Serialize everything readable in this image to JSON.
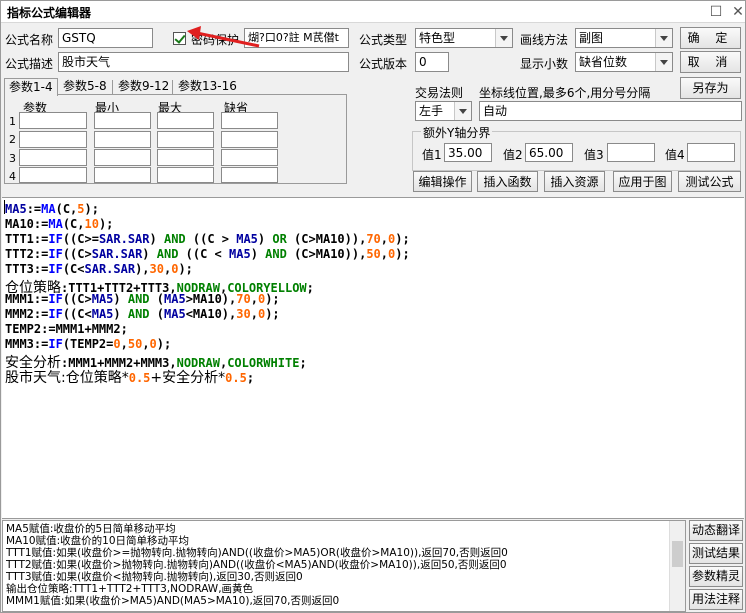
{
  "window": {
    "title": "指标公式编辑器",
    "max_icon": "☐",
    "close_icon": "✕"
  },
  "form": {
    "name_label": "公式名称",
    "name_value": "GSTQ",
    "pwd_checkbox_label": "密码保护",
    "pwd_value": "煳?口0?註  M芪僣t",
    "desc_label": "公式描述",
    "desc_value": "股市天气",
    "type_label": "公式类型",
    "type_value": "特色型",
    "draw_label": "画线方法",
    "draw_value": "副图",
    "version_label": "公式版本",
    "version_value": "0",
    "decimals_label": "显示小数",
    "decimals_value": "缺省位数"
  },
  "buttons": {
    "ok": "确  定",
    "cancel": "取  消",
    "save_as": "另存为",
    "edit_ops": "编辑操作",
    "insert_func": "插入函数",
    "insert_res": "插入资源",
    "apply_chart": "应用于图",
    "test_formula": "测试公式"
  },
  "tabs": [
    "参数1-4",
    "参数5-8",
    "参数9-12",
    "参数13-16"
  ],
  "params": {
    "headers": [
      "参数",
      "最小",
      "最大",
      "缺省"
    ],
    "rows": [
      "1",
      "2",
      "3",
      "4"
    ]
  },
  "trade": {
    "rule_label": "交易法则",
    "coord_label": "坐标线位置,最多6个,用分号分隔",
    "rule_value": "左手",
    "coord_value": "自动"
  },
  "yaxis": {
    "title": "额外Y轴分界",
    "v1_label": "值1",
    "v1": "35.00",
    "v2_label": "值2",
    "v2": "65.00",
    "v3_label": "值3",
    "v3": "",
    "v4_label": "值4",
    "v4": ""
  },
  "code_lines": [
    [
      {
        "t": "MA5",
        "c": "kp"
      },
      {
        "t": ":="
      },
      {
        "t": "MA",
        "c": "kf"
      },
      {
        "t": "(C,"
      },
      {
        "t": "5",
        "c": "kc"
      },
      {
        "t": ");"
      }
    ],
    [
      {
        "t": "MA10:="
      },
      {
        "t": "MA",
        "c": "kf"
      },
      {
        "t": "(C,"
      },
      {
        "t": "10",
        "c": "kc"
      },
      {
        "t": ");"
      }
    ],
    [
      {
        "t": "TTT1:="
      },
      {
        "t": "IF",
        "c": "kf"
      },
      {
        "t": "((C>="
      },
      {
        "t": "SAR.SAR",
        "c": "kp"
      },
      {
        "t": ") "
      },
      {
        "t": "AND",
        "c": "kb"
      },
      {
        "t": " ((C > "
      },
      {
        "t": "MA5",
        "c": "kp"
      },
      {
        "t": ") "
      },
      {
        "t": "OR",
        "c": "kb"
      },
      {
        "t": " (C>MA10)),"
      },
      {
        "t": "70",
        "c": "kc"
      },
      {
        "t": ","
      },
      {
        "t": "0",
        "c": "kc"
      },
      {
        "t": ");"
      }
    ],
    [
      {
        "t": "TTT2:="
      },
      {
        "t": "IF",
        "c": "kf"
      },
      {
        "t": "((C>"
      },
      {
        "t": "SAR.SAR",
        "c": "kp"
      },
      {
        "t": ") "
      },
      {
        "t": "AND",
        "c": "kb"
      },
      {
        "t": " ((C < "
      },
      {
        "t": "MA5",
        "c": "kp"
      },
      {
        "t": ") "
      },
      {
        "t": "AND",
        "c": "kb"
      },
      {
        "t": " (C>MA10)),"
      },
      {
        "t": "50",
        "c": "kc"
      },
      {
        "t": ","
      },
      {
        "t": "0",
        "c": "kc"
      },
      {
        "t": ");"
      }
    ],
    [
      {
        "t": "TTT3:="
      },
      {
        "t": "IF",
        "c": "kf"
      },
      {
        "t": "(C<"
      },
      {
        "t": "SAR.SAR",
        "c": "kp"
      },
      {
        "t": "),"
      },
      {
        "t": "30",
        "c": "kc"
      },
      {
        "t": ","
      },
      {
        "t": "0",
        "c": "kc"
      },
      {
        "t": ");"
      }
    ],
    [
      {
        "t": "仓位策略",
        "cn": 1
      },
      {
        "t": ":TTT1+TTT2+TTT3,"
      },
      {
        "t": "NODRAW",
        "c": "kb"
      },
      {
        "t": ","
      },
      {
        "t": "COLORYELLOW",
        "c": "kb"
      },
      {
        "t": ";"
      }
    ],
    [
      {
        "t": "MMM1:="
      },
      {
        "t": "IF",
        "c": "kf"
      },
      {
        "t": "((C>"
      },
      {
        "t": "MA5",
        "c": "kp"
      },
      {
        "t": ") "
      },
      {
        "t": "AND",
        "c": "kb"
      },
      {
        "t": " ("
      },
      {
        "t": "MA5",
        "c": "kp"
      },
      {
        "t": ">MA10),"
      },
      {
        "t": "70",
        "c": "kc"
      },
      {
        "t": ","
      },
      {
        "t": "0",
        "c": "kc"
      },
      {
        "t": ");"
      }
    ],
    [
      {
        "t": "MMM2:="
      },
      {
        "t": "IF",
        "c": "kf"
      },
      {
        "t": "((C<"
      },
      {
        "t": "MA5",
        "c": "kp"
      },
      {
        "t": ") "
      },
      {
        "t": "AND",
        "c": "kb"
      },
      {
        "t": " ("
      },
      {
        "t": "MA5",
        "c": "kp"
      },
      {
        "t": "<MA10),"
      },
      {
        "t": "30",
        "c": "kc"
      },
      {
        "t": ","
      },
      {
        "t": "0",
        "c": "kc"
      },
      {
        "t": ");"
      }
    ],
    [
      {
        "t": "TEMP2:=MMM1+MMM2;"
      }
    ],
    [
      {
        "t": "MMM3:="
      },
      {
        "t": "IF",
        "c": "kf"
      },
      {
        "t": "(TEMP2="
      },
      {
        "t": "0",
        "c": "kc"
      },
      {
        "t": ","
      },
      {
        "t": "50",
        "c": "kc"
      },
      {
        "t": ","
      },
      {
        "t": "0",
        "c": "kc"
      },
      {
        "t": ");"
      }
    ],
    [
      {
        "t": "安全分析",
        "cn": 1
      },
      {
        "t": ":MMM1+MMM2+MMM3,"
      },
      {
        "t": "NODRAW",
        "c": "kb"
      },
      {
        "t": ","
      },
      {
        "t": "COLORWHITE",
        "c": "kb"
      },
      {
        "t": ";"
      }
    ],
    [
      {
        "t": "股市天气:仓位策略*",
        "cn": 1
      },
      {
        "t": "0.5",
        "c": "kc"
      },
      {
        "t": "+安全分析*",
        "cn": 1
      },
      {
        "t": "0.5",
        "c": "kc"
      },
      {
        "t": ";"
      }
    ]
  ],
  "output_lines": [
    "MA5赋值:收盘价的5日简单移动平均",
    "MA10赋值:收盘价的10日简单移动平均",
    "TTT1赋值:如果(收盘价>=抛物转向.抛物转向)AND((收盘价>MA5)OR(收盘价>MA10)),返回70,否则返回0",
    "TTT2赋值:如果(收盘价>抛物转向.抛物转向)AND((收盘价<MA5)AND(收盘价>MA10)),返回50,否则返回0",
    "TTT3赋值:如果(收盘价<抛物转向.抛物转向),返回30,否则返回0",
    "输出仓位策略:TTT1+TTT2+TTT3,NODRAW,画黄色",
    "MMM1赋值:如果(收盘价>MA5)AND(MA5>MA10),返回70,否则返回0"
  ],
  "side_buttons": [
    "动态翻译",
    "测试结果",
    "参数精灵",
    "用法注释"
  ],
  "colors": {
    "accent_arrow": "#e02020",
    "func": "#0000ff",
    "bool": "#008000",
    "const": "#ff6600"
  }
}
